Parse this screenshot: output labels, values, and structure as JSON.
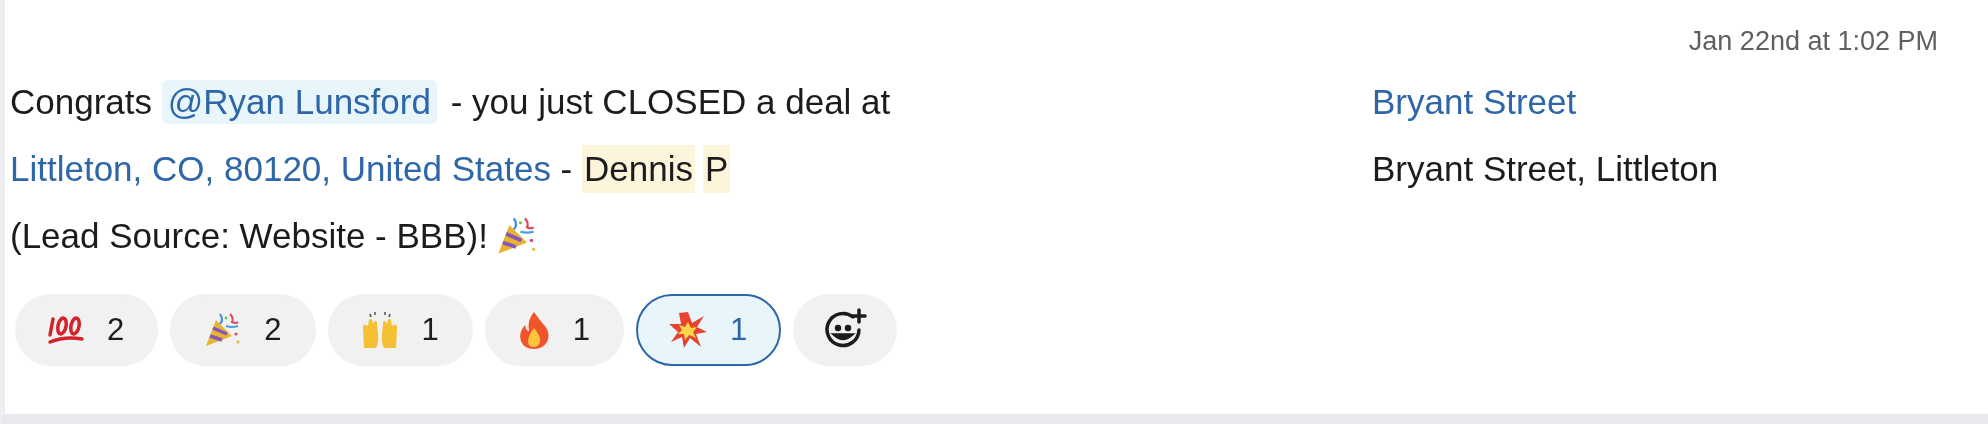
{
  "message": {
    "timestamp": "Jan 22nd at 1:02 PM",
    "lines": [
      {
        "segments": [
          {
            "kind": "text",
            "text": "Congrats "
          },
          {
            "kind": "mention",
            "text": "@Ryan Lunsford"
          },
          {
            "kind": "text",
            "text": " - you just CLOSED a deal at"
          },
          {
            "kind": "redacted"
          }
        ],
        "after": [
          {
            "kind": "link",
            "text": "Bryant Street"
          }
        ]
      },
      {
        "segments": [
          {
            "kind": "link",
            "text": "Littleton, CO, 80120, United States"
          },
          {
            "kind": "text",
            "text": " - "
          },
          {
            "kind": "highlight",
            "text": "Dennis"
          },
          {
            "kind": "highlight",
            "text": "P"
          },
          {
            "kind": "redacted"
          }
        ],
        "after": [
          {
            "kind": "text",
            "text": "Bryant Street, Littleton"
          }
        ]
      },
      {
        "segments": [
          {
            "kind": "text",
            "text": "(Lead Source: Website - BBB)!"
          },
          {
            "kind": "party"
          }
        ]
      }
    ]
  },
  "reactions": [
    {
      "kind": "hundred",
      "count": "2",
      "selected": false
    },
    {
      "kind": "party",
      "count": "2",
      "selected": false
    },
    {
      "kind": "hands",
      "count": "1",
      "selected": false
    },
    {
      "kind": "fire",
      "count": "1",
      "selected": false
    },
    {
      "kind": "boom",
      "count": "1",
      "selected": true
    }
  ]
}
